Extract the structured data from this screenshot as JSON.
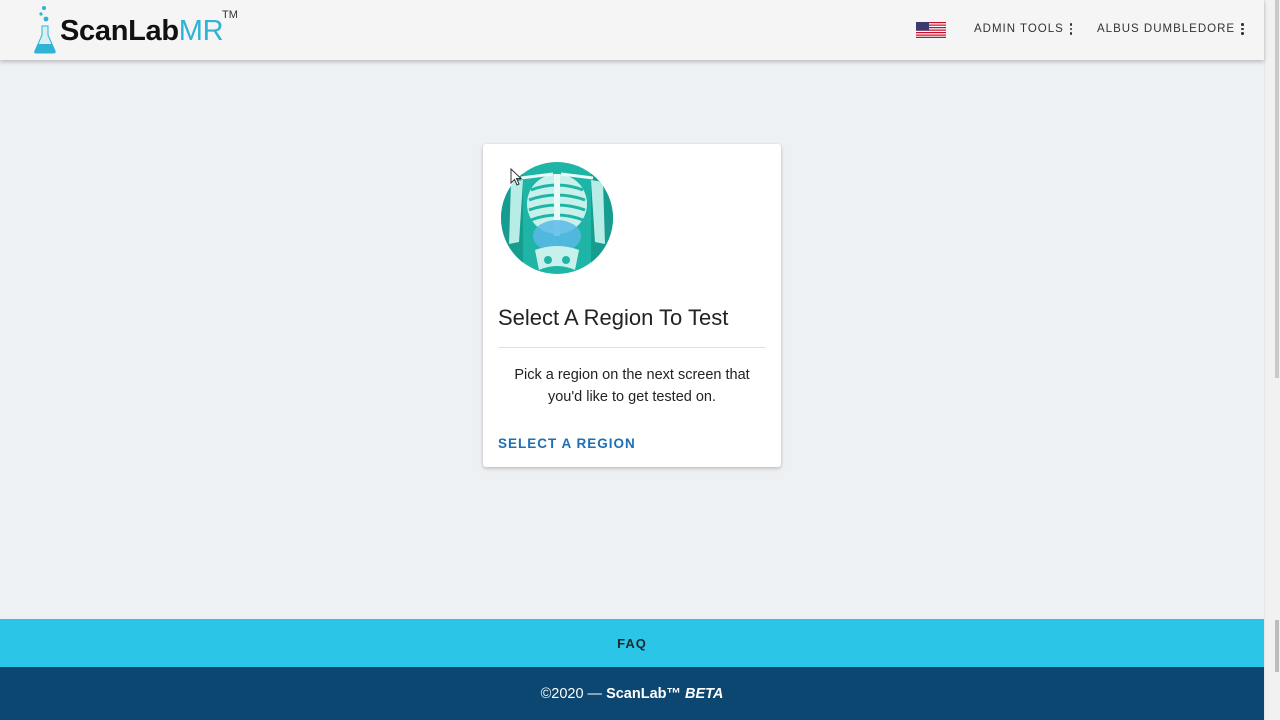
{
  "header": {
    "logo": {
      "main": "ScanLab",
      "accent": "MR",
      "tm": "TM"
    },
    "language_flag": "us-flag-icon",
    "admin_tools_label": "ADMIN TOOLS",
    "user_label": "ALBUS DUMBLEDORE"
  },
  "card": {
    "image": "skeleton-torso-xray",
    "title": "Select A Region To Test",
    "description": "Pick a region on the next screen that you'd like to get tested on.",
    "action_label": "SELECT A REGION"
  },
  "footer": {
    "faq_label": "FAQ",
    "copyright_prefix": "©2020 —",
    "brand": "ScanLab™",
    "beta": "BETA"
  },
  "colors": {
    "accent_cyan": "#2ac5e7",
    "footer_navy": "#0b4770",
    "link_blue": "#1d6fb8",
    "logo_teal": "#2eb3d4"
  }
}
